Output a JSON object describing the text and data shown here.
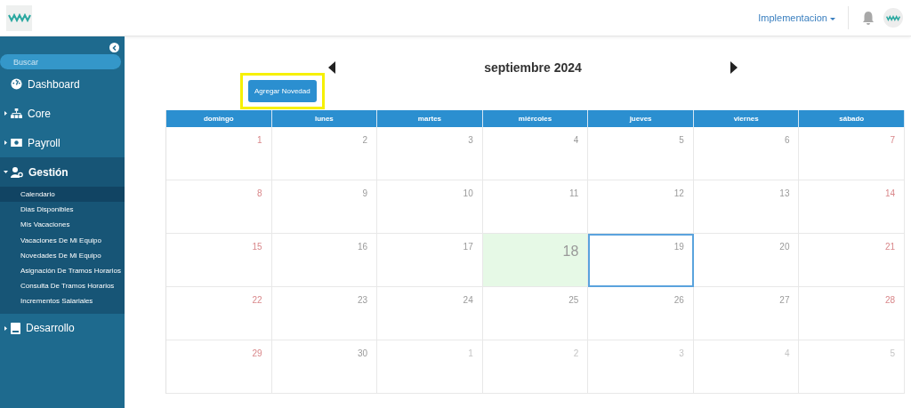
{
  "header": {
    "user_menu": "Implementacion"
  },
  "sidebar": {
    "search": {
      "placeholder": "Buscar"
    },
    "items": [
      {
        "label": "Dashboard"
      },
      {
        "label": "Core",
        "expanded": false
      },
      {
        "label": "Payroll",
        "expanded": false
      },
      {
        "label": "Gestión",
        "expanded": true,
        "children": [
          {
            "label": "Calendario",
            "selected": true
          },
          {
            "label": "Dias Disponibles",
            "selected": false
          },
          {
            "label": "Mis Vacaciones",
            "selected": false
          },
          {
            "label": "Vacaciones De Mi Equipo",
            "selected": false
          },
          {
            "label": "Novedades De Mi Equipo",
            "selected": false
          },
          {
            "label": "Asignación De Tramos Horarios",
            "selected": false
          },
          {
            "label": "Consulta De Tramos Horarios",
            "selected": false
          },
          {
            "label": "Incrementos Salariales",
            "selected": false
          }
        ]
      },
      {
        "label": "Desarrollo",
        "expanded": false
      }
    ]
  },
  "calendar": {
    "title": "septiembre 2024",
    "add_button": {
      "label": "Agregar Novedad",
      "highlighted": true
    },
    "weekdays": [
      "domingo",
      "lunes",
      "martes",
      "miércoles",
      "jueves",
      "viernes",
      "sábado"
    ],
    "weeks": [
      [
        {
          "day": "1",
          "today": false,
          "selected": false,
          "other_month": false
        },
        {
          "day": "2",
          "today": false,
          "selected": false,
          "other_month": false
        },
        {
          "day": "3",
          "today": false,
          "selected": false,
          "other_month": false
        },
        {
          "day": "4",
          "today": false,
          "selected": false,
          "other_month": false
        },
        {
          "day": "5",
          "today": false,
          "selected": false,
          "other_month": false
        },
        {
          "day": "6",
          "today": false,
          "selected": false,
          "other_month": false
        },
        {
          "day": "7",
          "today": false,
          "selected": false,
          "other_month": false
        }
      ],
      [
        {
          "day": "8",
          "today": false,
          "selected": false,
          "other_month": false
        },
        {
          "day": "9",
          "today": false,
          "selected": false,
          "other_month": false
        },
        {
          "day": "10",
          "today": false,
          "selected": false,
          "other_month": false
        },
        {
          "day": "11",
          "today": false,
          "selected": false,
          "other_month": false
        },
        {
          "day": "12",
          "today": false,
          "selected": false,
          "other_month": false
        },
        {
          "day": "13",
          "today": false,
          "selected": false,
          "other_month": false
        },
        {
          "day": "14",
          "today": false,
          "selected": false,
          "other_month": false
        }
      ],
      [
        {
          "day": "15",
          "today": false,
          "selected": false,
          "other_month": false
        },
        {
          "day": "16",
          "today": false,
          "selected": false,
          "other_month": false
        },
        {
          "day": "17",
          "today": false,
          "selected": false,
          "other_month": false
        },
        {
          "day": "18",
          "today": true,
          "selected": false,
          "other_month": false
        },
        {
          "day": "19",
          "today": false,
          "selected": true,
          "other_month": false
        },
        {
          "day": "20",
          "today": false,
          "selected": false,
          "other_month": false
        },
        {
          "day": "21",
          "today": false,
          "selected": false,
          "other_month": false
        }
      ],
      [
        {
          "day": "22",
          "today": false,
          "selected": false,
          "other_month": false
        },
        {
          "day": "23",
          "today": false,
          "selected": false,
          "other_month": false
        },
        {
          "day": "24",
          "today": false,
          "selected": false,
          "other_month": false
        },
        {
          "day": "25",
          "today": false,
          "selected": false,
          "other_month": false
        },
        {
          "day": "26",
          "today": false,
          "selected": false,
          "other_month": false
        },
        {
          "day": "27",
          "today": false,
          "selected": false,
          "other_month": false
        },
        {
          "day": "28",
          "today": false,
          "selected": false,
          "other_month": false
        }
      ],
      [
        {
          "day": "29",
          "today": false,
          "selected": false,
          "other_month": false
        },
        {
          "day": "30",
          "today": false,
          "selected": false,
          "other_month": false
        },
        {
          "day": "1",
          "today": false,
          "selected": false,
          "other_month": true
        },
        {
          "day": "2",
          "today": false,
          "selected": false,
          "other_month": true
        },
        {
          "day": "3",
          "today": false,
          "selected": false,
          "other_month": true
        },
        {
          "day": "4",
          "today": false,
          "selected": false,
          "other_month": true
        },
        {
          "day": "5",
          "today": false,
          "selected": false,
          "other_month": true
        }
      ]
    ]
  }
}
